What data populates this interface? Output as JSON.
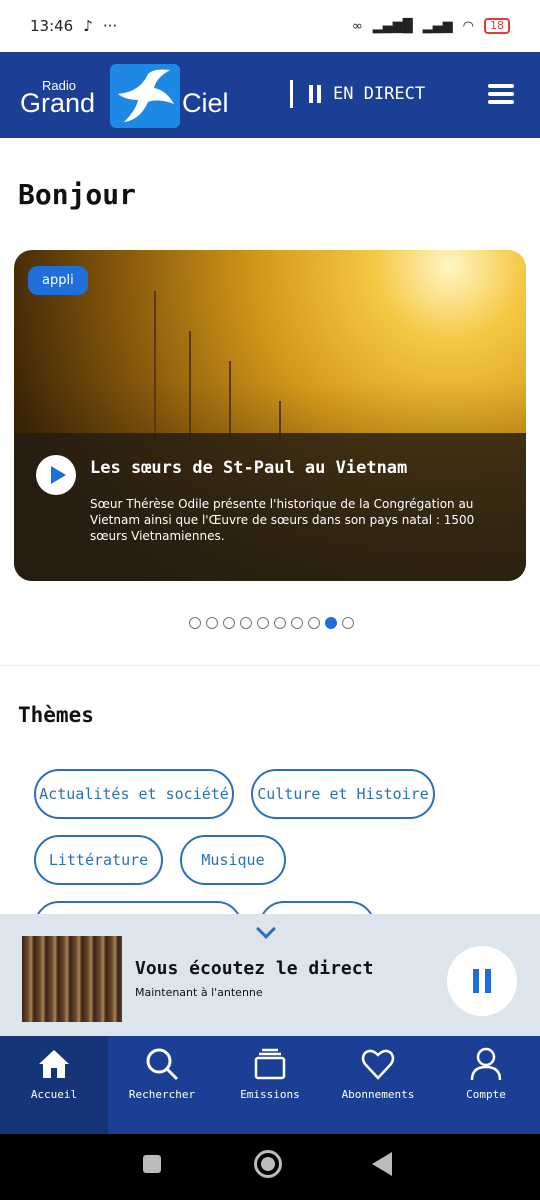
{
  "status_bar": {
    "time": "13:46",
    "battery": "18"
  },
  "header": {
    "logo_radio": "Radio",
    "logo_grand": "Grand",
    "logo_ciel": "Ciel",
    "live_label": "EN DIRECT"
  },
  "greeting": "Bonjour",
  "featured": {
    "tag": "appli",
    "title": "Les sœurs de St-Paul au Vietnam",
    "description": "Sœur Thérèse Odile présente l'historique de la Congrégation au Vietnam ainsi que l'Œuvre de sœurs dans son pays natal : 1500 sœurs Vietnamiennes.",
    "carousel_total": 10,
    "carousel_active": 9
  },
  "themes": {
    "title": "Thèmes",
    "chips": [
      "Actualités et société",
      "Culture et Histoire",
      "Littérature",
      "Musique"
    ]
  },
  "player": {
    "title": "Vous écoutez le direct",
    "subtitle": "Maintenant à l'antenne"
  },
  "tabs": [
    "Accueil",
    "Rechercher",
    "Emissions",
    "Abonnements",
    "Compte"
  ],
  "colors": {
    "brand_blue": "#1b3f95",
    "accent_blue": "#1e6fd9"
  }
}
